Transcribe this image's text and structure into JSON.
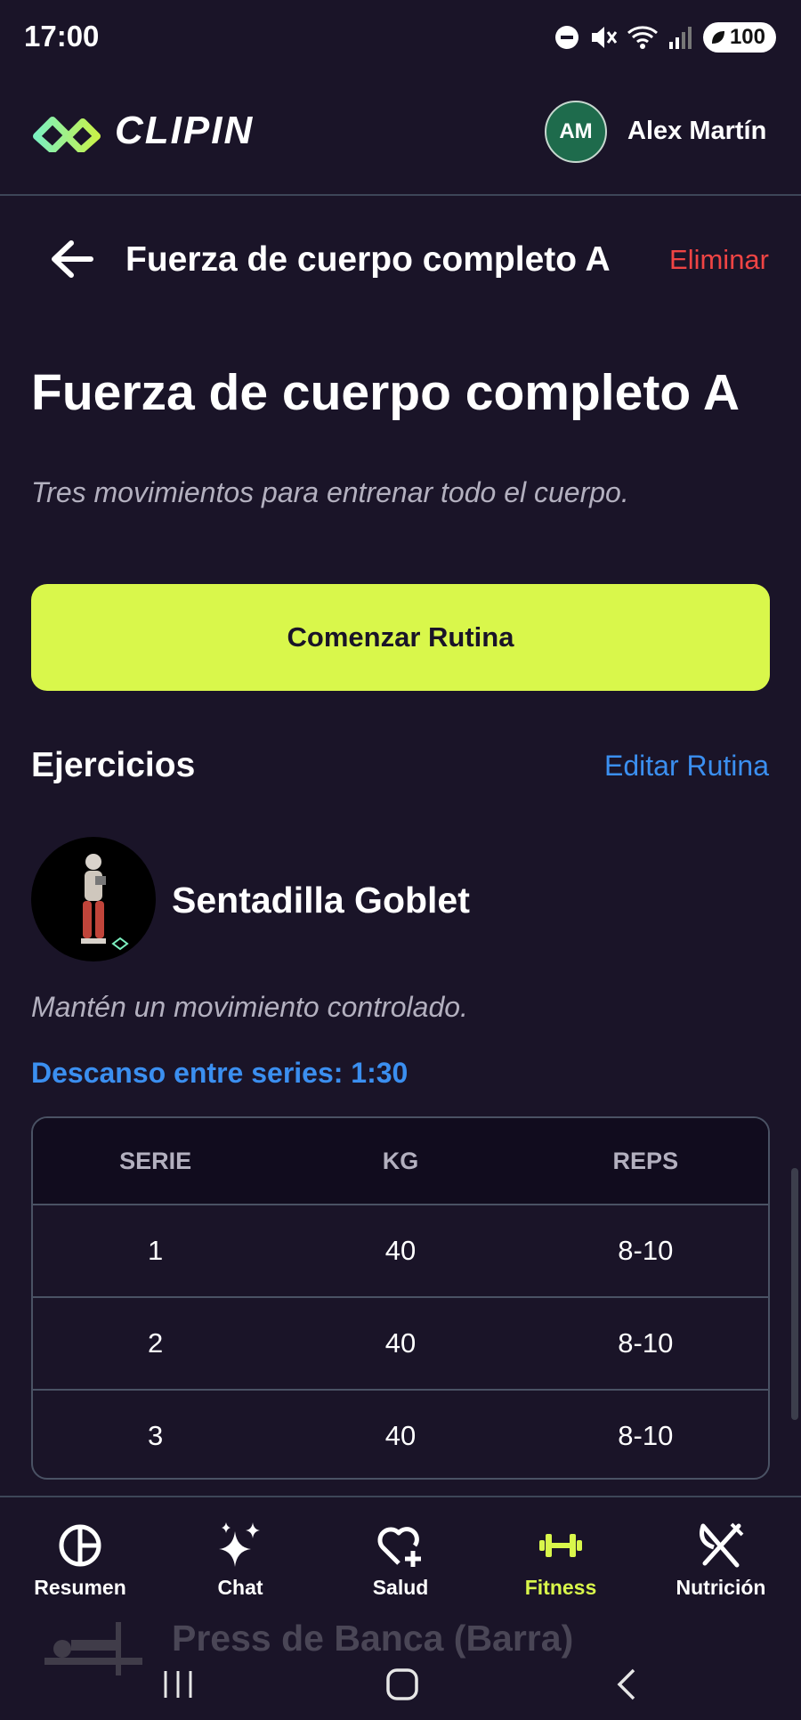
{
  "status_bar": {
    "time": "17:00",
    "battery": "100"
  },
  "header": {
    "brand": "CLIPIN",
    "user_initials": "AM",
    "user_name": "Alex Martín"
  },
  "nav": {
    "title": "Fuerza de cuerpo completo A",
    "delete_label": "Eliminar"
  },
  "routine": {
    "title": "Fuerza de cuerpo completo A",
    "description": "Tres movimientos para entrenar todo el cuerpo.",
    "start_label": "Comenzar Rutina"
  },
  "exercises_section": {
    "title": "Ejercicios",
    "edit_label": "Editar Rutina"
  },
  "exercise": {
    "name": "Sentadilla Goblet",
    "note": "Mantén un movimiento controlado.",
    "rest": "Descanso entre series: 1:30",
    "columns": [
      "SERIE",
      "KG",
      "REPS"
    ],
    "sets": [
      [
        "1",
        "40",
        "8-10"
      ],
      [
        "2",
        "40",
        "8-10"
      ],
      [
        "3",
        "40",
        "8-10"
      ]
    ]
  },
  "next_exercise": {
    "name": "Press de Banca (Barra)"
  },
  "bottom_nav": {
    "items": [
      {
        "label": "Resumen",
        "icon": "pie-chart-icon"
      },
      {
        "label": "Chat",
        "icon": "sparkles-icon"
      },
      {
        "label": "Salud",
        "icon": "heart-plus-icon"
      },
      {
        "label": "Fitness",
        "icon": "dumbbell-icon",
        "active": true
      },
      {
        "label": "Nutrición",
        "icon": "utensils-icon"
      }
    ]
  },
  "colors": {
    "background": "#1a1428",
    "accent": "#d9f74b",
    "link": "#3b8ff0",
    "danger": "#ef4444"
  }
}
